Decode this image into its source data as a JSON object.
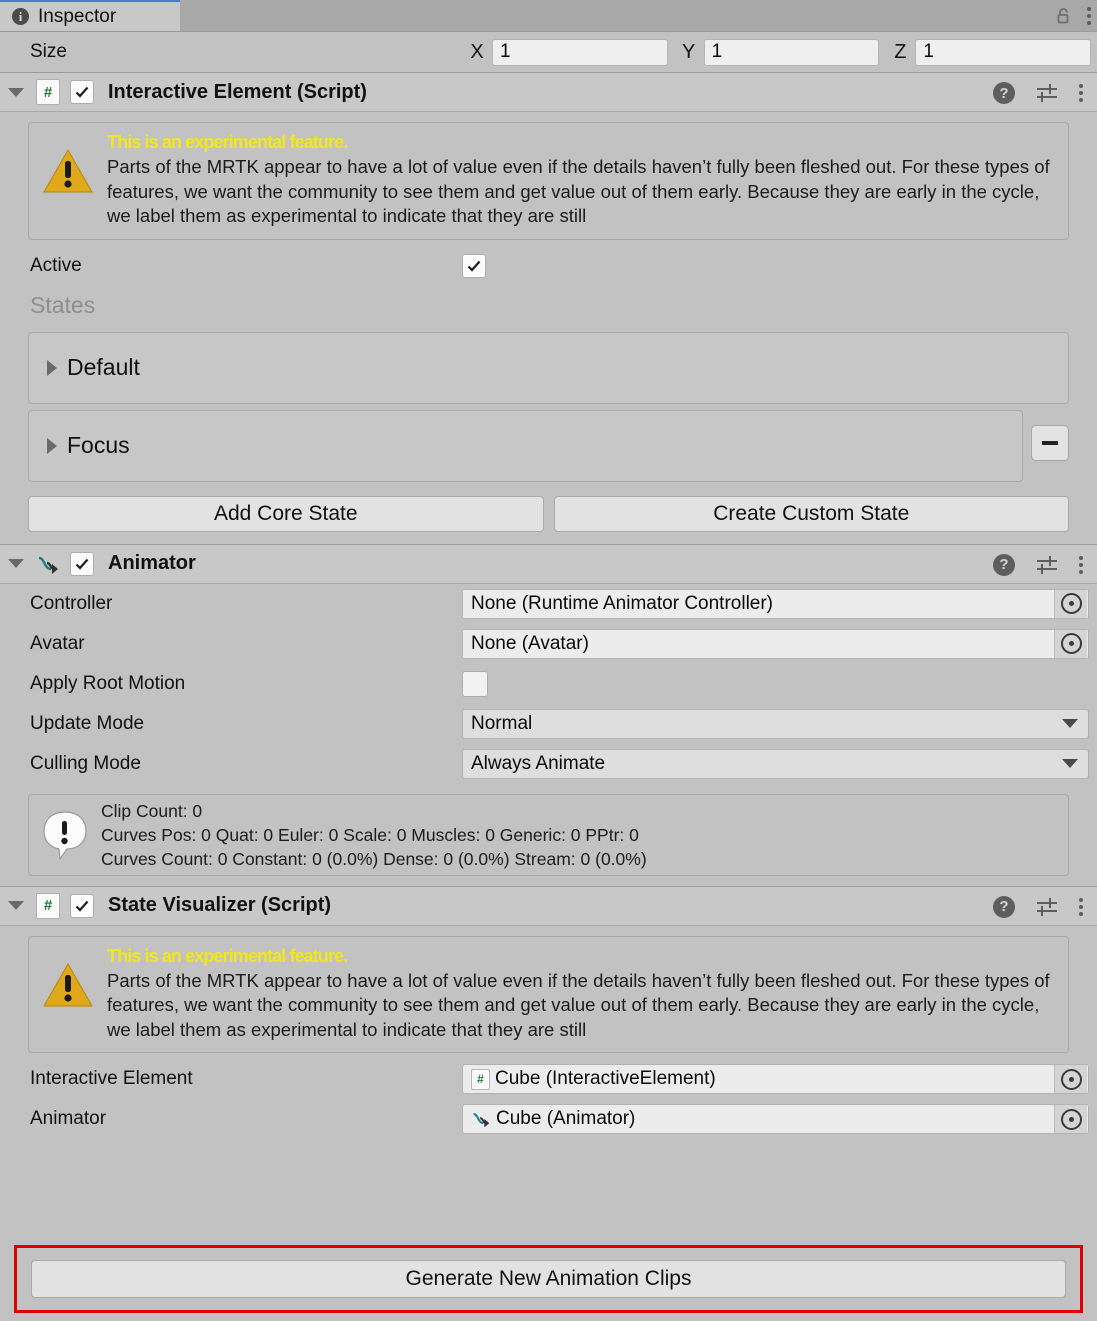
{
  "window": {
    "tab_label": "Inspector",
    "tab_icon": "info-icon",
    "lock_icon": "unlocked-padlock-icon",
    "menu_icon": "kebab-menu-icon"
  },
  "size_row": {
    "label": "Size",
    "axes": [
      {
        "axis": "X",
        "value": "1"
      },
      {
        "axis": "Y",
        "value": "1"
      },
      {
        "axis": "Z",
        "value": "1"
      }
    ]
  },
  "experimental_notice": {
    "title": "This is an experimental feature.",
    "body": "Parts of the MRTK appear to have a lot of value even if the details haven’t fully been fleshed out. For these types of features, we want the community to see them and get value out of them early. Because they are early in the cycle, we label them as experimental to indicate that they are still",
    "icon": "warning-triangle-icon"
  },
  "interactive_element": {
    "header": {
      "title": "Interactive Element (Script)",
      "script_glyph": "#",
      "enabled": true,
      "help_icon": "help-question-icon",
      "preset_icon": "preset-sliders-icon",
      "menu_icon": "kebab-menu-icon"
    },
    "active": {
      "label": "Active",
      "checked": true
    },
    "states_header": "States",
    "states": [
      {
        "label": "Default",
        "removable": false
      },
      {
        "label": "Focus",
        "removable": true,
        "remove_label": "−"
      }
    ],
    "buttons": {
      "add_core_state": "Add Core State",
      "create_custom_state": "Create Custom State"
    }
  },
  "animator": {
    "header": {
      "title": "Animator",
      "icon": "animator-arrow-icon",
      "enabled": true,
      "help_icon": "help-question-icon",
      "preset_icon": "preset-sliders-icon",
      "menu_icon": "kebab-menu-icon"
    },
    "fields": {
      "controller_label": "Controller",
      "controller_value": "None (Runtime Animator Controller)",
      "avatar_label": "Avatar",
      "avatar_value": "None (Avatar)",
      "apply_root_motion_label": "Apply Root Motion",
      "apply_root_motion_checked": false,
      "update_mode_label": "Update Mode",
      "update_mode_value": "Normal",
      "culling_mode_label": "Culling Mode",
      "culling_mode_value": "Always Animate"
    },
    "info": {
      "icon": "info-bubble-icon",
      "line1": "Clip Count: 0",
      "line2": "Curves Pos: 0 Quat: 0 Euler: 0 Scale: 0 Muscles: 0 Generic: 0 PPtr: 0",
      "line3": "Curves Count: 0 Constant: 0 (0.0%) Dense: 0 (0.0%) Stream: 0 (0.0%)"
    }
  },
  "state_visualizer": {
    "header": {
      "title": "State Visualizer (Script)",
      "script_glyph": "#",
      "enabled": true,
      "help_icon": "help-question-icon",
      "preset_icon": "preset-sliders-icon",
      "menu_icon": "kebab-menu-icon"
    },
    "fields": {
      "interactive_element_label": "Interactive Element",
      "interactive_element_value": "Cube (InteractiveElement)",
      "animator_label": "Animator",
      "animator_value": "Cube (Animator)"
    },
    "generate_button": "Generate New Animation Clips"
  },
  "colors": {
    "panel_bg": "#c2c2c2",
    "header_bg": "#c8c8c8",
    "field_bg": "#ececec",
    "warning_yellow": "#f2e71c",
    "warning_icon": "#e0a91c",
    "script_green": "#1f7a32",
    "animator_teal": "#1f7f8c",
    "highlight_red": "#e00000",
    "tab_accent": "#3e7fd0"
  }
}
